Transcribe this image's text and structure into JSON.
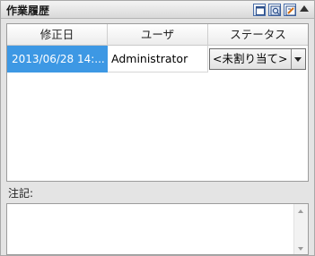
{
  "panel": {
    "title": "作業履歴",
    "toolbar_icons": [
      "window-icon",
      "export-icon",
      "edit-icon"
    ],
    "collapse_icon": "chevron-up-icon"
  },
  "grid": {
    "columns": [
      "修正日",
      "ユーザ",
      "ステータス"
    ],
    "rows": [
      {
        "date": "2013/06/28 14:...",
        "user": "Administrator",
        "status": "<未割り当て>",
        "selected": true
      }
    ]
  },
  "notes": {
    "label": "注記:",
    "value": ""
  },
  "colors": {
    "selection": "#3d98e4",
    "title_bg": "#e4e4e4"
  }
}
